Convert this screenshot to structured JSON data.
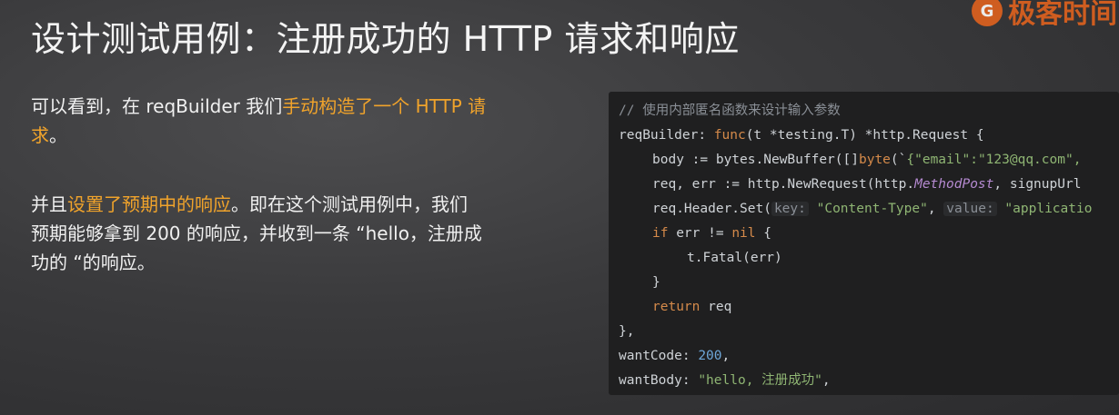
{
  "slide": {
    "title": "设计测试用例：注册成功的 HTTP 请求和响应",
    "logo_text": "极客时间",
    "logo_tag": "极客",
    "para1": {
      "prefix": "可以看到，在 reqBuilder 我们",
      "highlight": "手动构造了一个 HTTP 请",
      "line2_hl": "求",
      "line2_rest": "。"
    },
    "para2": {
      "prefix": "并且",
      "highlight": "设置了预期中的响应",
      "rest": "。即在这个测试用例中，我们",
      "line2": "预期能够拿到 200 的响应，并收到一条 “hello，注册成",
      "line3": "功的 “的响应。"
    }
  },
  "code": {
    "comment": "// 使用内部匿名函数来设计输入参数",
    "l2_name": "reqBuilder",
    "l2_sep": ": ",
    "l2_func": "func",
    "l2_sig": "(t *testing.T) *http.Request {",
    "l3_a": "body := bytes.NewBuffer([]",
    "l3_byte": "byte",
    "l3_b": "(`",
    "l3_str": "{\"email\":\"123@qq.com\",",
    "l4_a": "req, err := http.NewRequest(http.",
    "l4_method": "MethodPost",
    "l4_b": ", signupUrl",
    "l5_a": "req.Header.Set(",
    "l5_hint_key": "key:",
    "l5_str1": "\"Content-Type\"",
    "l5_comma": ", ",
    "l5_hint_value": "value:",
    "l5_str2": "\"applicatio",
    "l6_if": "if",
    "l6_rest": " err != ",
    "l6_nil": "nil",
    "l6_end": " {",
    "l7": "t.Fatal(err)",
    "l8": "}",
    "l9_ret": "return",
    "l9_rest": " req",
    "l10": "},",
    "l11_name": "wantCode",
    "l11_sep": ": ",
    "l11_num": "200",
    "l11_end": ",",
    "l12_name": "wantBody",
    "l12_sep": ": ",
    "l12_str": "\"hello, 注册成功\"",
    "l12_end": ","
  }
}
